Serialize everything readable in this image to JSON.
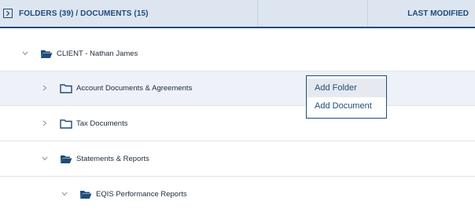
{
  "header": {
    "title": "FOLDERS (39) / DOCUMENTS (15)",
    "last_modified": "LAST MODIFIED"
  },
  "tree": {
    "items": [
      {
        "label": "CLIENT - Nathan James",
        "state": "expanded",
        "icon": "folder-open-icon"
      },
      {
        "label": "Account Documents & Agreements",
        "state": "collapsed",
        "icon": "folder-icon"
      },
      {
        "label": "Tax Documents",
        "state": "collapsed",
        "icon": "folder-icon"
      },
      {
        "label": "Statements & Reports",
        "state": "expanded",
        "icon": "folder-open-icon"
      },
      {
        "label": "EQIS Performance Reports",
        "state": "expanded",
        "icon": "folder-open-icon"
      }
    ]
  },
  "context_menu": {
    "items": [
      "Add Folder",
      "Add Document"
    ]
  },
  "colors": {
    "accent": "#1f4c79",
    "header_bg": "#dde5f0",
    "row_highlight": "#eef2f8"
  }
}
